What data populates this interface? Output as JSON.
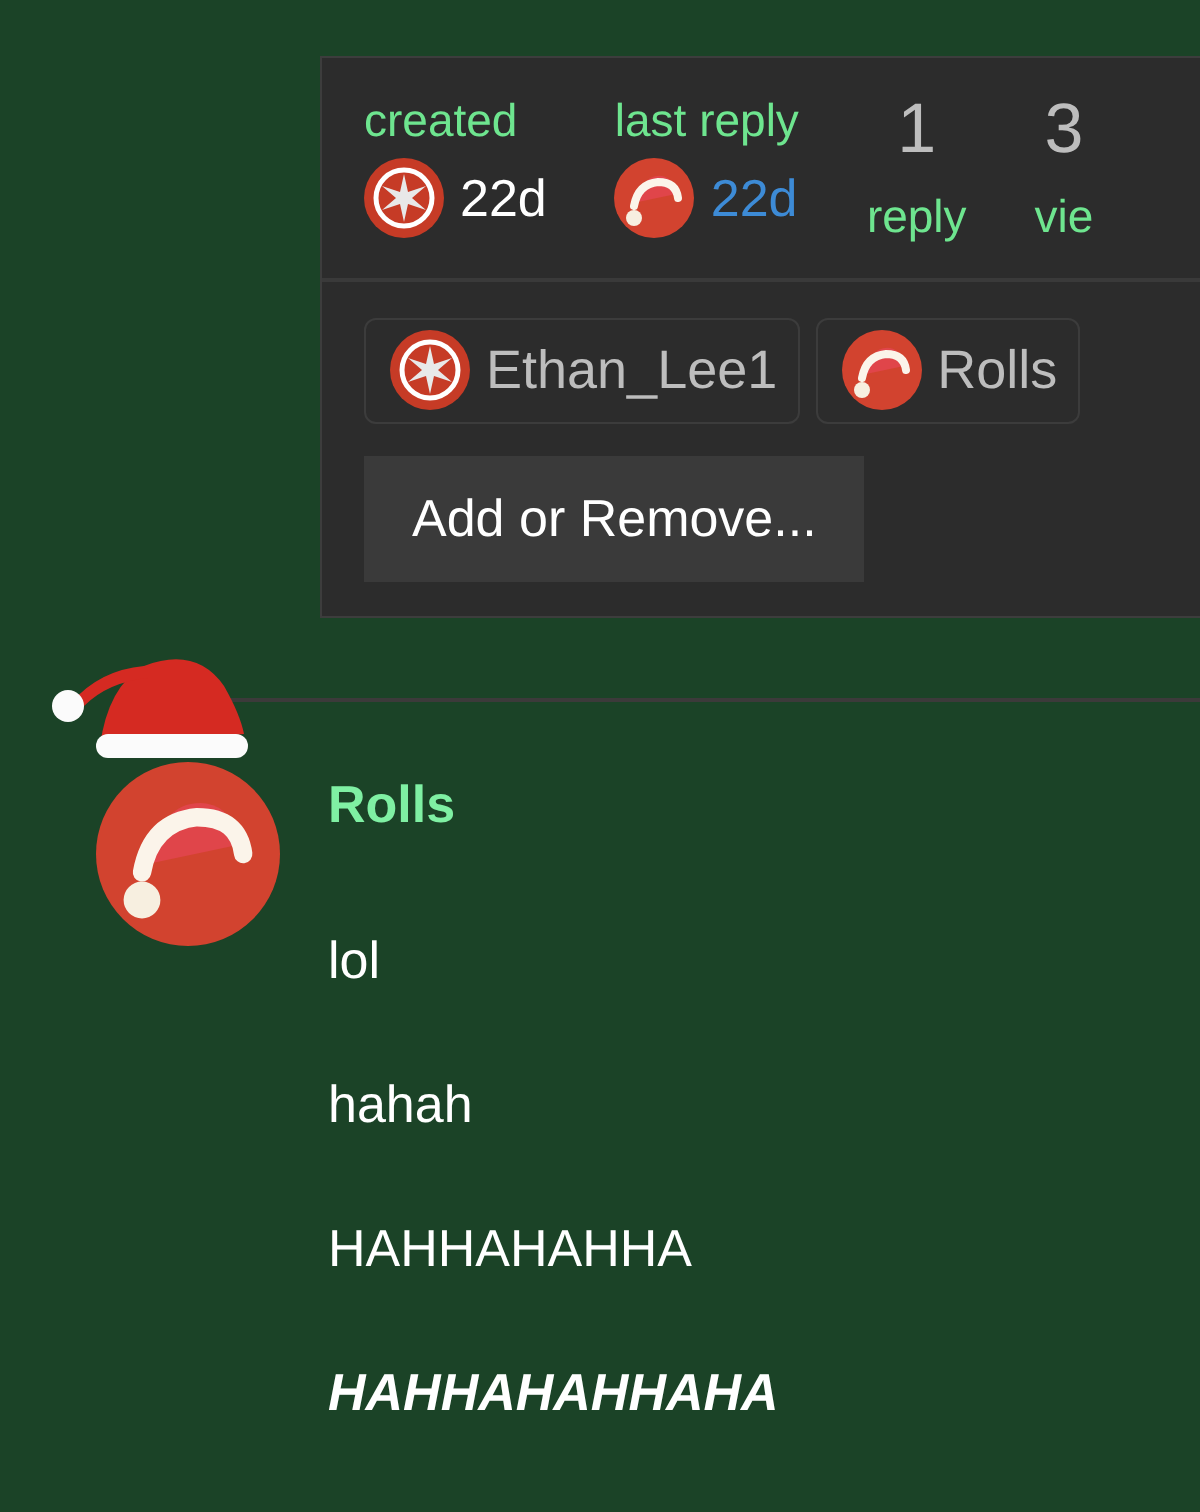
{
  "topic_map": {
    "stats": [
      {
        "kind": "created",
        "label": "created",
        "avatar": {
          "kind": "star"
        },
        "time": "22d"
      },
      {
        "kind": "last_reply",
        "label": "last reply",
        "avatar": {
          "kind": "hat"
        },
        "time": "22d"
      },
      {
        "kind": "count",
        "number": "1",
        "label": "reply"
      },
      {
        "kind": "count",
        "number": "3",
        "label": "vie"
      }
    ],
    "participants": [
      {
        "name": "Ethan_Lee1",
        "avatar": {
          "kind": "star"
        }
      },
      {
        "name": "Rolls",
        "avatar": {
          "kind": "hat"
        }
      }
    ],
    "button": "Add or Remove..."
  },
  "post": {
    "author": "Rolls",
    "avatar": {
      "kind": "hat"
    },
    "festive_hat": true,
    "lines": [
      {
        "kind": "plain",
        "text": "lol"
      },
      {
        "kind": "plain",
        "text": "hahah"
      },
      {
        "kind": "plain",
        "text": "HAHHAHAHHA"
      },
      {
        "kind": "emphasized",
        "text": "HAHHAHAHHAHA"
      }
    ]
  }
}
